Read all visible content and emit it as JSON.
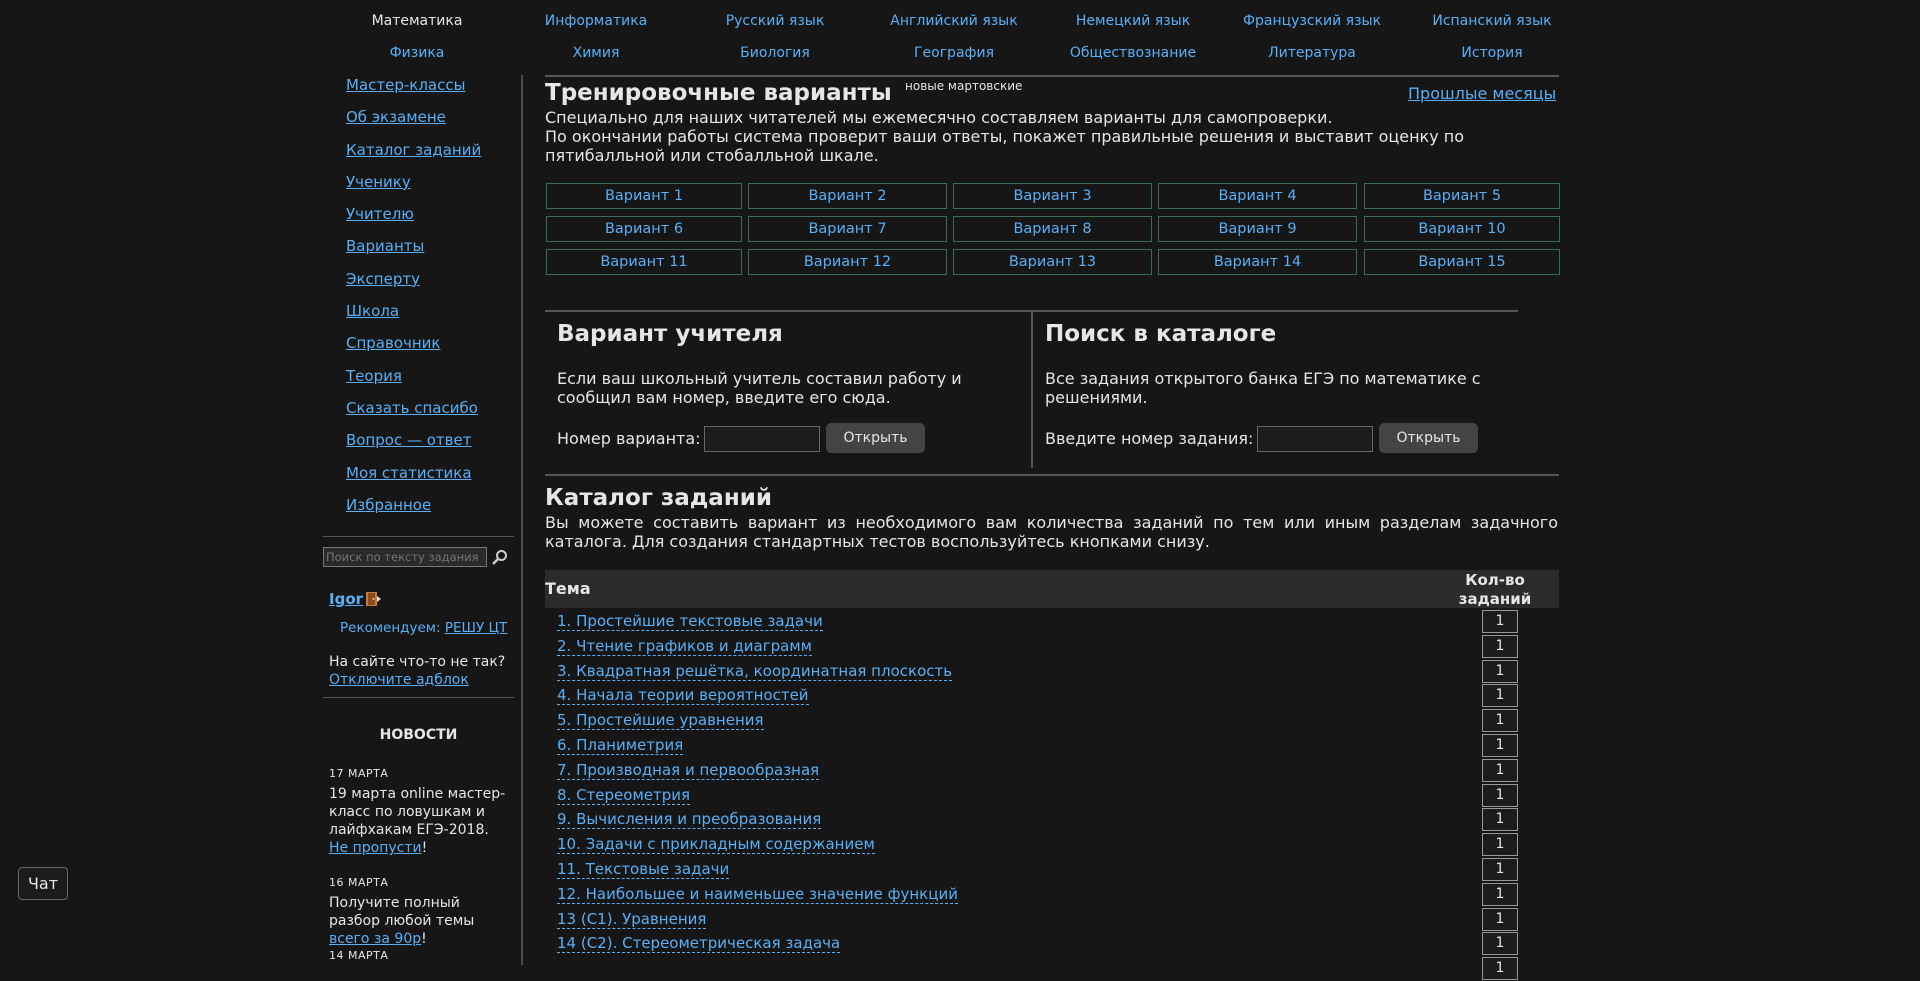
{
  "subjects": [
    [
      "Математика",
      "Информатика",
      "Русский язык",
      "Английский язык",
      "Немецкий язык",
      "Французский язык",
      "Испанский язык"
    ],
    [
      "Физика",
      "Химия",
      "Биология",
      "География",
      "Обществознание",
      "Литература",
      "История"
    ]
  ],
  "current_subject": "Математика",
  "sidebar": {
    "items": [
      "Мастер-классы",
      "Об экзамене",
      "Каталог заданий",
      "Ученику",
      "Учителю",
      "Варианты",
      "Эксперту",
      "Школа",
      "Справочник",
      "Теория",
      "Сказать спасибо",
      "Вопрос — ответ",
      "Моя статистика",
      "Избранное"
    ],
    "search_placeholder": "Поиск по тексту задания",
    "user_name": "Igor",
    "recommend_label": "Рекомендуем:",
    "recommend_link": "РЕШУ ЦТ",
    "adblock_text": "На сайте что-то не так?",
    "adblock_link": "Отключите адблок",
    "news_title": "НОВОСТИ",
    "news": [
      {
        "date": "17 МАРТА",
        "text": "19 марта online мастер-класс по ловушкам и лайфхакам ЕГЭ-2018.",
        "link": "Не пропусти",
        "tail": "!"
      },
      {
        "date": "16 МАРТА",
        "text": "Получите полный разбор любой темы ",
        "link": "всего за 90р",
        "tail": "!"
      },
      {
        "date": "14 МАРТА",
        "text": "",
        "link": "",
        "tail": ""
      }
    ]
  },
  "chat_label": "Чат",
  "training": {
    "title": "Тренировочные варианты",
    "sup": "новые мартовские",
    "past_link": "Прошлые месяцы",
    "desc_line1": "Специально для наших читателей мы ежемесячно составляем варианты для самопроверки.",
    "desc_line2": "По окончании работы система проверит ваши ответы, покажет правильные решения и выставит оценку по пятибалльной или стобалльной шкале.",
    "variants": [
      "Вариант 1",
      "Вариант 2",
      "Вариант 3",
      "Вариант 4",
      "Вариант 5",
      "Вариант 6",
      "Вариант 7",
      "Вариант 8",
      "Вариант 9",
      "Вариант 10",
      "Вариант 11",
      "Вариант 12",
      "Вариант 13",
      "Вариант 14",
      "Вариант 15"
    ]
  },
  "teacher_box": {
    "title": "Вариант учителя",
    "text": "Если ваш школьный учитель составил работу и сообщил вам номер, введите его сюда.",
    "label": "Номер варианта:",
    "button": "Открыть"
  },
  "search_box": {
    "title": "Поиск в каталоге",
    "text": "Все задания открытого банка ЕГЭ по математике с решениями.",
    "label": "Введите номер задания:",
    "button": "Открыть"
  },
  "catalog": {
    "title": "Каталог заданий",
    "desc": "Вы можете составить вариант из необходимого вам количества заданий по тем или иным разделам задачного каталога. Для создания стандартных тестов воспользуйтесь кнопками снизу.",
    "col_topic": "Тема",
    "col_count": "Кол-во заданий",
    "rows": [
      {
        "topic": "1. Простейшие текстовые задачи",
        "count": "1"
      },
      {
        "topic": "2. Чтение графиков и диаграмм",
        "count": "1"
      },
      {
        "topic": "3. Квадратная решётка, координатная плоскость",
        "count": "1"
      },
      {
        "topic": "4. Начала теории вероятностей",
        "count": "1"
      },
      {
        "topic": "5. Простейшие уравнения",
        "count": "1"
      },
      {
        "topic": "6. Планиметрия",
        "count": "1"
      },
      {
        "topic": "7. Производная и первообразная",
        "count": "1"
      },
      {
        "topic": "8. Стереометрия",
        "count": "1"
      },
      {
        "topic": "9. Вычисления и преобразования",
        "count": "1"
      },
      {
        "topic": "10. Задачи с прикладным содержанием",
        "count": "1"
      },
      {
        "topic": "11. Текстовые задачи",
        "count": "1"
      },
      {
        "topic": "12. Наибольшее и наименьшее значение функций",
        "count": "1"
      },
      {
        "topic": "13 (С1). Уравнения",
        "count": "1"
      },
      {
        "topic": "14 (С2). Стереометрическая задача",
        "count": "1"
      },
      {
        "topic": "",
        "count": "1"
      }
    ]
  }
}
